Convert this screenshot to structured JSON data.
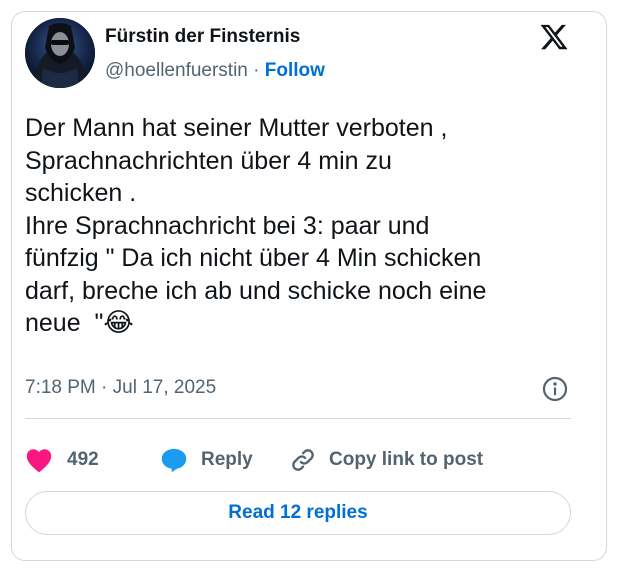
{
  "author": {
    "display_name": "Fürstin der Finsternis",
    "handle": "@hoellenfuerstin",
    "separator": " · ",
    "follow_label": "Follow"
  },
  "post": {
    "text": "Der Mann hat seiner Mutter verboten ,\nSprachnachrichten über 4 min zu\nschicken .\nIhre Sprachnachricht bei 3: paar und\nfünfzig \" Da ich nicht über 4 Min schicken\ndarf, breche ich ab und schicke noch eine\nneue  \"",
    "emoji": "😂",
    "timestamp": "7:18 PM · Jul 17, 2025"
  },
  "actions": {
    "like_count": "492",
    "reply_label": "Reply",
    "copy_link_label": "Copy link to post"
  },
  "read_replies_label": "Read 12 replies",
  "icons": {
    "brand": "x-logo-icon",
    "info": "info-icon",
    "like": "heart-icon",
    "reply": "speech-bubble-icon",
    "copy": "link-icon"
  },
  "colors": {
    "text": "#0f1419",
    "secondary": "#536471",
    "link": "#006fd6",
    "heart": "#f91880",
    "reply_bubble": "#1d9bf0",
    "border": "#cfd9de"
  }
}
